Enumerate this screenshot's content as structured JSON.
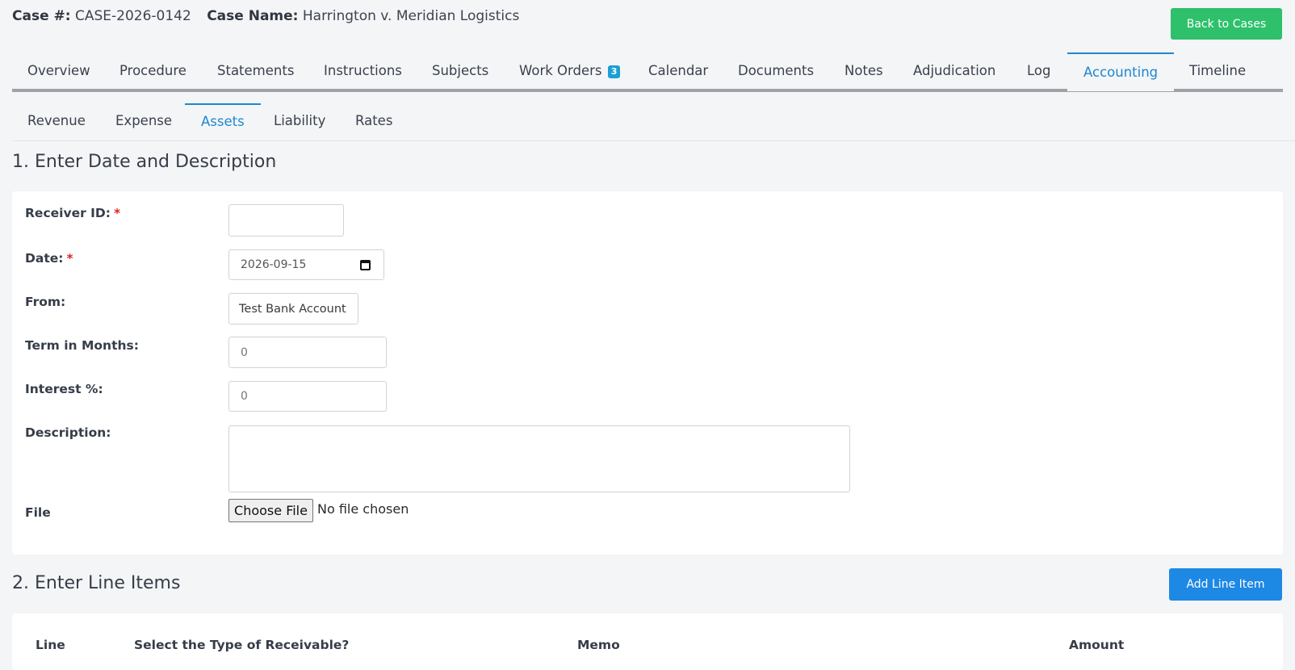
{
  "header": {
    "case_num_label": "Case #:",
    "case_num": "CASE-2026-0142",
    "case_name_label": "Case Name:",
    "case_name": "Harrington v. Meridian Logistics",
    "back_button": "Back to Cases"
  },
  "tabs": [
    {
      "label": "Overview"
    },
    {
      "label": "Procedure"
    },
    {
      "label": "Statements"
    },
    {
      "label": "Instructions"
    },
    {
      "label": "Subjects"
    },
    {
      "label": "Work Orders",
      "badge": "3"
    },
    {
      "label": "Calendar"
    },
    {
      "label": "Documents"
    },
    {
      "label": "Notes"
    },
    {
      "label": "Adjudication"
    },
    {
      "label": "Log"
    },
    {
      "label": "Accounting",
      "active": true
    },
    {
      "label": "Timeline"
    }
  ],
  "subtabs": [
    {
      "label": "Revenue"
    },
    {
      "label": "Expense"
    },
    {
      "label": "Assets",
      "active": true
    },
    {
      "label": "Liability"
    },
    {
      "label": "Rates"
    }
  ],
  "section1": {
    "title": "1. Enter Date and Description",
    "fields": {
      "receiver_id": {
        "label": "Receiver ID:",
        "required": "*",
        "value": ""
      },
      "date": {
        "label": "Date:",
        "required": "*",
        "value": "2026-09-15"
      },
      "from": {
        "label": "From:",
        "value": "Test Bank Account"
      },
      "term": {
        "label": "Term in Months:",
        "placeholder": "0"
      },
      "interest": {
        "label": "Interest %:",
        "placeholder": "0"
      },
      "description": {
        "label": "Description:",
        "value": ""
      },
      "file": {
        "label": "File",
        "button": "Choose File",
        "status": "No file chosen"
      }
    }
  },
  "section2": {
    "title": "2. Enter Line Items",
    "add_button": "Add Line Item",
    "columns": [
      "Line",
      "Select the Type of Receivable?",
      "Memo",
      "Amount"
    ]
  },
  "colors": {
    "accent": "#1e88d0",
    "success": "#2ec06b",
    "primary_button": "#1e88e5",
    "required": "#e02424",
    "badge": "#1a9fd6"
  }
}
